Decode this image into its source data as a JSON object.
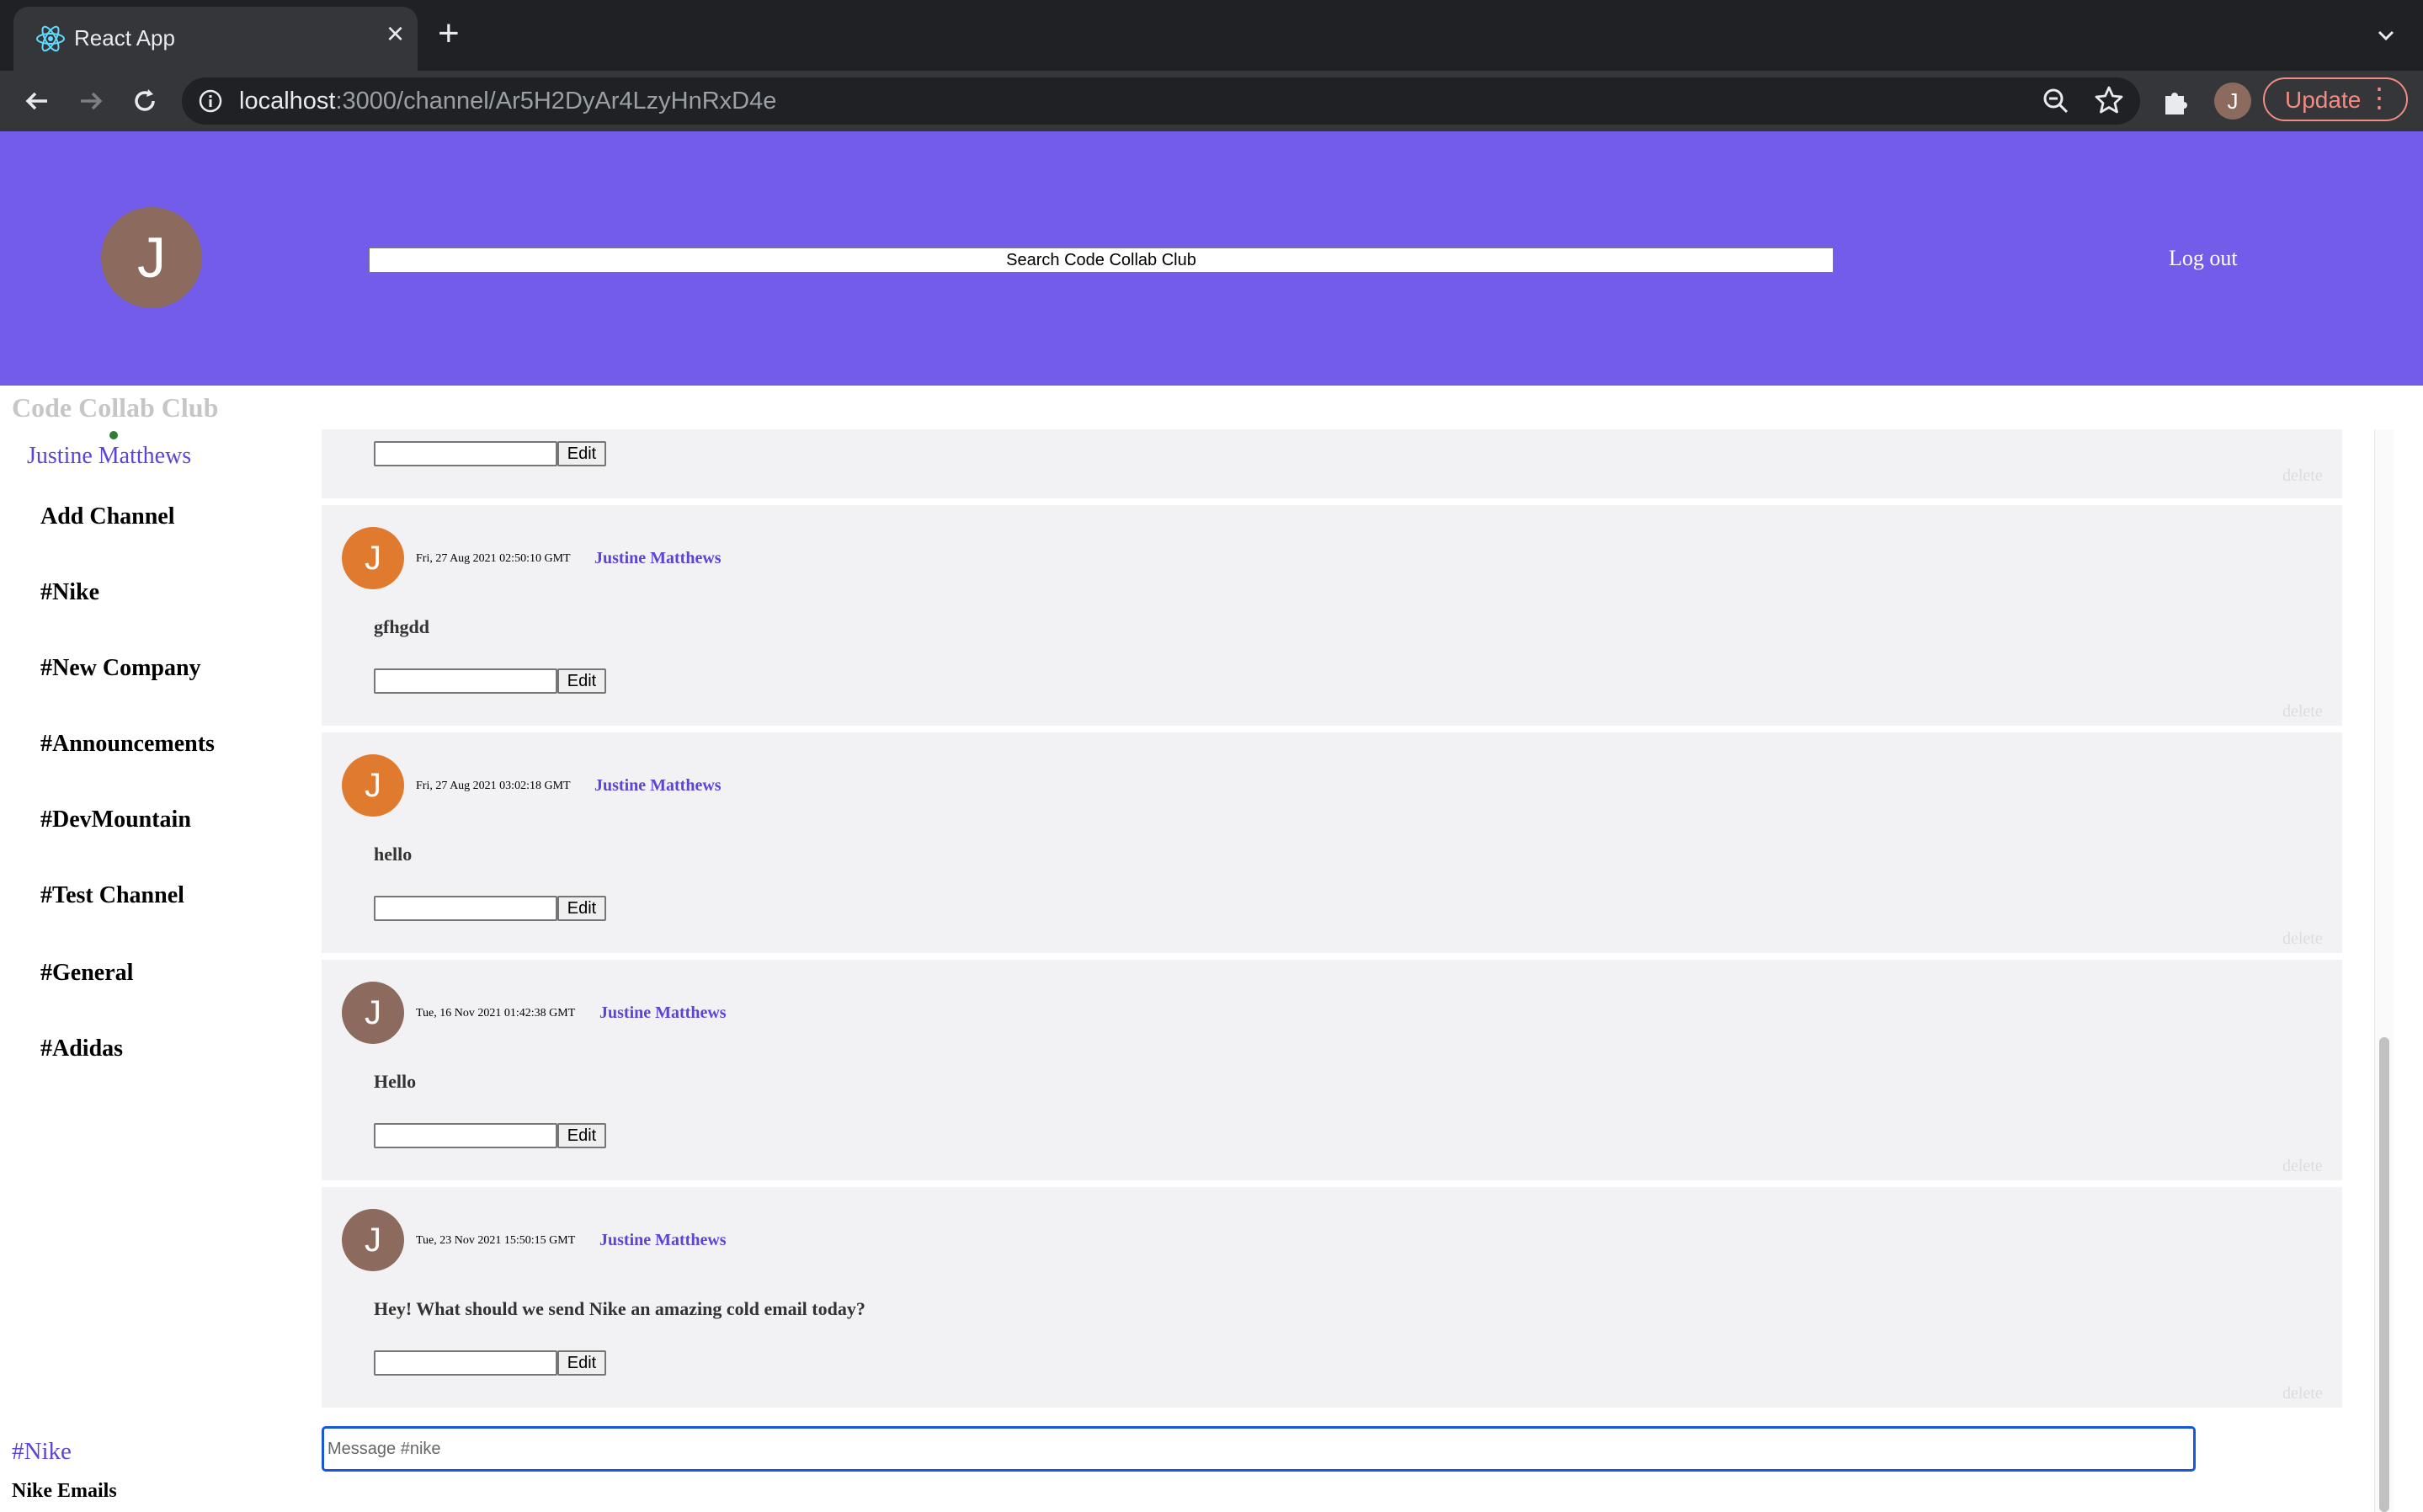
{
  "browser": {
    "tab_title": "React App",
    "url_host": "localhost",
    "url_rest": ":3000/channel/Ar5H2DyAr4LzyHnRxD4e",
    "profile_initial": "J",
    "update_label": "Update"
  },
  "header": {
    "avatar_initial": "J",
    "search_placeholder": "Search Code Collab Club",
    "logout_label": "Log out"
  },
  "sidebar": {
    "brand": "Code Collab Club",
    "user_name": "Justine Matthews",
    "add_channel": "Add Channel",
    "channels": [
      "#Nike",
      "#New Company",
      "#Announcements",
      "#DevMountain",
      "#Test Channel",
      "#General",
      "#Adidas"
    ],
    "current_channel": "#Nike",
    "current_description": "Nike Emails"
  },
  "messages": [
    {
      "time": "Fri, 27 Aug 2021 02:50:10 GMT",
      "author": "Justine Matthews",
      "text": "gfhgdd",
      "avatar_initial": "J",
      "avatar_color": "#e07a2f"
    },
    {
      "time": "Fri, 27 Aug 2021 03:02:18 GMT",
      "author": "Justine Matthews",
      "text": "hello",
      "avatar_initial": "J",
      "avatar_color": "#e07a2f"
    },
    {
      "time": "Tue, 16 Nov 2021 01:42:38 GMT",
      "author": "Justine Matthews",
      "text": "Hello",
      "avatar_initial": "J",
      "avatar_color": "#8c6a5d"
    },
    {
      "time": "Tue, 23 Nov 2021 15:50:15 GMT",
      "author": "Justine Matthews",
      "text": "Hey! What should we send Nike an amazing cold email today?",
      "avatar_initial": "J",
      "avatar_color": "#8c6a5d"
    }
  ],
  "message_actions": {
    "edit_label": "Edit",
    "delete_label": "delete"
  },
  "composer": {
    "placeholder": "Message #nike"
  },
  "colors": {
    "header_bg": "#735cea",
    "accent": "#5a45d6",
    "message_bg": "#f2f2f4"
  }
}
